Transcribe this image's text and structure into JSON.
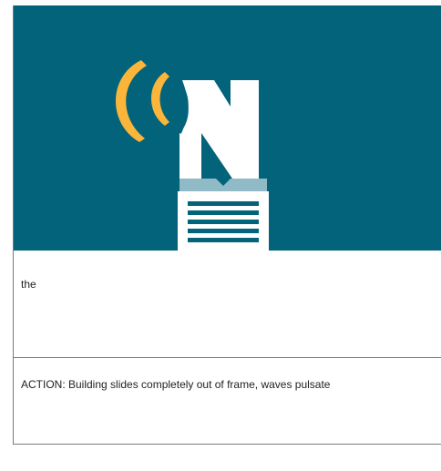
{
  "storyboard": {
    "image": {
      "background_color": "#02637a",
      "wave_color": "#fbb53b",
      "logo_color": "#ffffff",
      "document_color": "#ffffff",
      "document_tab_color": "#8fbac6",
      "icon": "on-air-news-building-icon"
    },
    "captions": [
      "the",
      "ACTION: Building slides completely out of frame, waves pulsate"
    ]
  }
}
